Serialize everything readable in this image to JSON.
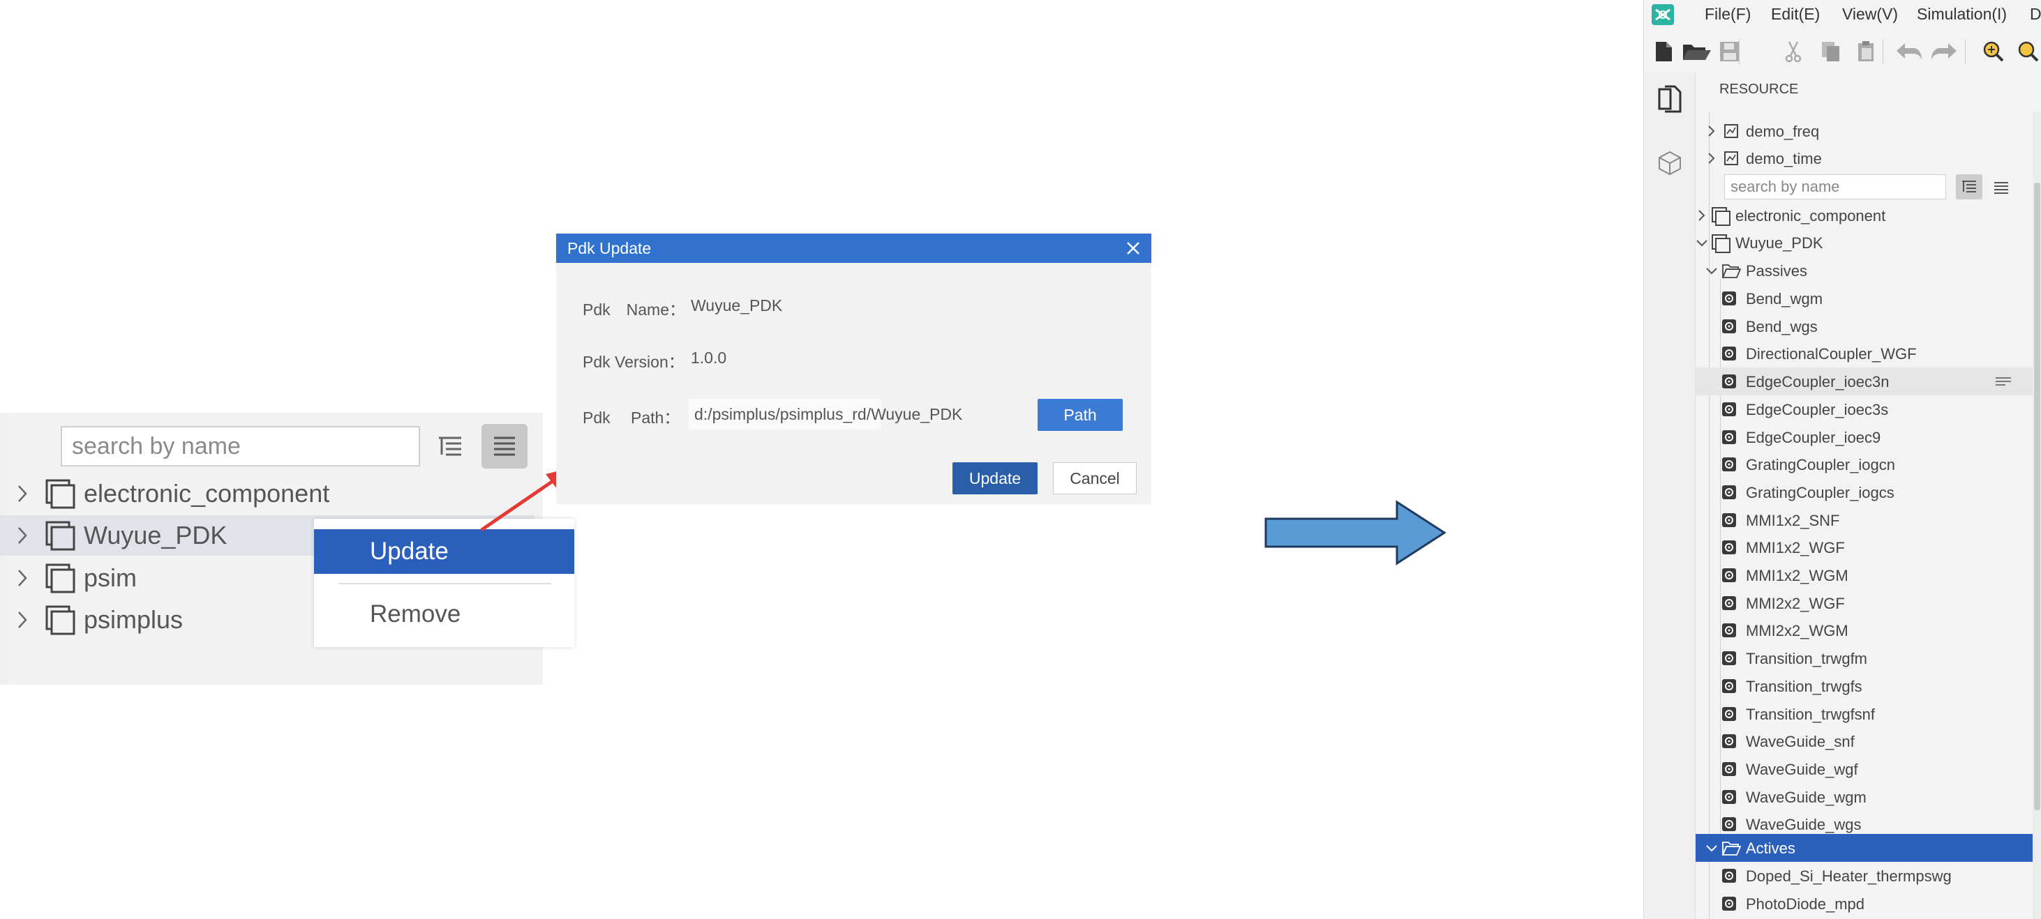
{
  "left_panel": {
    "search_placeholder": "search by name",
    "tree": [
      "electronic_component",
      "Wuyue_PDK",
      "psim",
      "psimplus"
    ],
    "selected": "Wuyue_PDK"
  },
  "context_menu": {
    "items": [
      "Update",
      "Remove"
    ]
  },
  "dialog": {
    "title": "Pdk Update",
    "name_label": "Pdk　Name：",
    "name_value": "Wuyue_PDK",
    "version_label": "Pdk Version：",
    "version_value": "1.0.0",
    "path_label": "Pdk　 Path：",
    "path_value": "d:/psimplus/psimplus_rd/Wuyue_PDK",
    "path_button": "Path",
    "update_button": "Update",
    "cancel_button": "Cancel"
  },
  "colors": {
    "accent": "#2b5fbc",
    "arrow_fill": "#5b9bd5",
    "arrow_stroke": "#1f3a5f",
    "pointer": "#e53935"
  },
  "app": {
    "menu": [
      "File(F)",
      "Edit(E)",
      "View(V)",
      "Simulation(I)",
      "D"
    ],
    "resource_label": "RESOURCE",
    "search_placeholder": "search by name",
    "top_items": [
      "demo_freq",
      "demo_time"
    ],
    "pdk_items": [
      "electronic_component",
      "Wuyue_PDK"
    ],
    "passives_label": "Passives",
    "passives": [
      "Bend_wgm",
      "Bend_wgs",
      "DirectionalCoupler_WGF",
      "EdgeCoupler_ioec3n",
      "EdgeCoupler_ioec3s",
      "EdgeCoupler_ioec9",
      "GratingCoupler_iogcn",
      "GratingCoupler_iogcs",
      "MMI1x2_SNF",
      "MMI1x2_WGF",
      "MMI1x2_WGM",
      "MMI2x2_WGF",
      "MMI2x2_WGM",
      "Transition_trwgfm",
      "Transition_trwgfs",
      "Transition_trwgfsnf",
      "WaveGuide_snf",
      "WaveGuide_wgf",
      "WaveGuide_wgm",
      "WaveGuide_wgs"
    ],
    "actives_label": "Actives",
    "actives": [
      "Doped_Si_Heater_thermpswg",
      "PhotoDiode_mpd"
    ]
  }
}
